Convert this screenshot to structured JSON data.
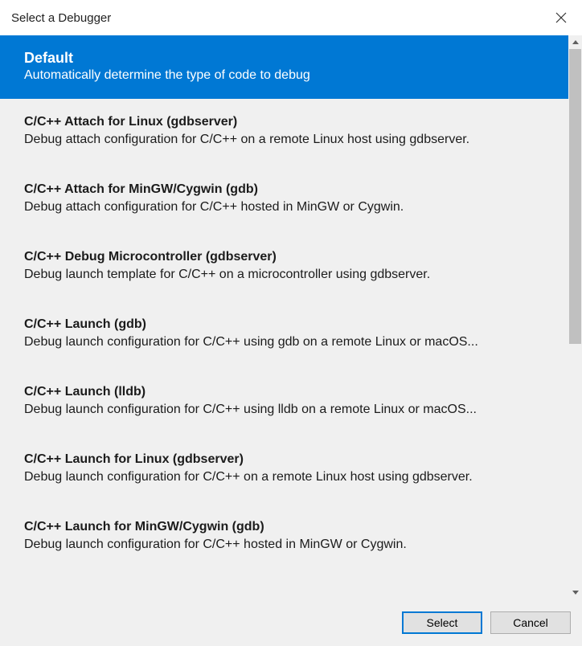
{
  "dialog": {
    "title": "Select a Debugger"
  },
  "items": [
    {
      "title": "Default",
      "desc": "Automatically determine the type of code to debug",
      "selected": true
    },
    {
      "title": "C/C++ Attach for Linux (gdbserver)",
      "desc": "Debug attach configuration for C/C++ on a remote Linux host using gdbserver."
    },
    {
      "title": "C/C++ Attach for MinGW/Cygwin (gdb)",
      "desc": "Debug attach configuration for C/C++ hosted in MinGW or Cygwin."
    },
    {
      "title": "C/C++ Debug Microcontroller (gdbserver)",
      "desc": "Debug launch template for C/C++ on a microcontroller using gdbserver."
    },
    {
      "title": "C/C++ Launch (gdb)",
      "desc": "Debug launch configuration for C/C++ using gdb on a remote Linux or macOS..."
    },
    {
      "title": "C/C++ Launch (lldb)",
      "desc": "Debug launch configuration for C/C++ using lldb on a remote Linux or macOS..."
    },
    {
      "title": "C/C++ Launch for Linux (gdbserver)",
      "desc": "Debug launch configuration for C/C++ on a remote Linux host using gdbserver."
    },
    {
      "title": "C/C++ Launch for MinGW/Cygwin (gdb)",
      "desc": "Debug launch configuration for C/C++ hosted in MinGW or Cygwin."
    }
  ],
  "buttons": {
    "select": "Select",
    "cancel": "Cancel"
  }
}
